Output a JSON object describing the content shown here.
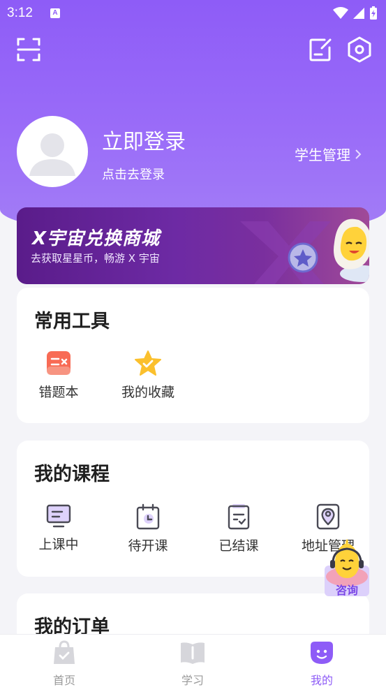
{
  "status": {
    "time": "3:12",
    "a_badge": "A"
  },
  "header": {
    "login_title": "立即登录",
    "login_sub": "点击去登录",
    "student_mgmt": "学生管理"
  },
  "banner": {
    "title": "X宇宙兑换商城",
    "subtitle": "去获取星星币，畅游 X 宇宙"
  },
  "tools": {
    "title": "常用工具",
    "items": [
      {
        "label": "错题本",
        "icon": "mistake-book-icon"
      },
      {
        "label": "我的收藏",
        "icon": "favorite-star-icon"
      }
    ]
  },
  "courses": {
    "title": "我的课程",
    "items": [
      {
        "label": "上课中",
        "icon": "in-class-icon"
      },
      {
        "label": "待开课",
        "icon": "upcoming-course-icon"
      },
      {
        "label": "已结课",
        "icon": "finished-course-icon"
      },
      {
        "label": "地址管理",
        "icon": "address-icon"
      }
    ]
  },
  "orders": {
    "title": "我的订单"
  },
  "fab": {
    "label": "咨询"
  },
  "tabbar": {
    "items": [
      {
        "label": "首页"
      },
      {
        "label": "学习"
      },
      {
        "label": "我的"
      }
    ]
  },
  "colors": {
    "accent": "#8e5cf7",
    "mistake_icon": "#f86b55",
    "star": "#fbc02d"
  }
}
